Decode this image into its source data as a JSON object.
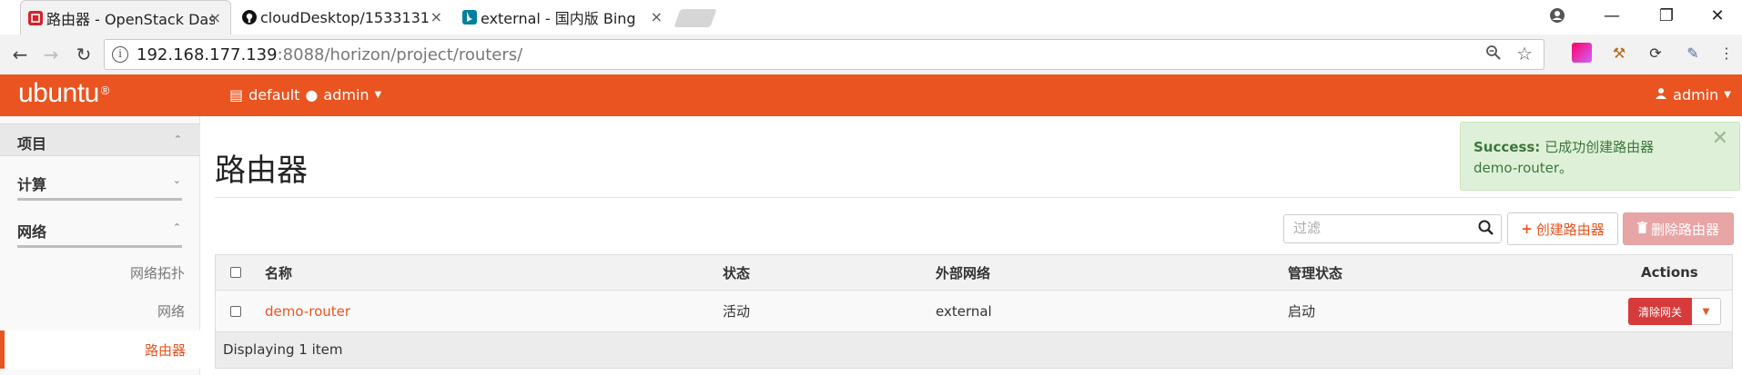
{
  "browser": {
    "tabs": [
      {
        "title": "路由器 - OpenStack Das",
        "favicon": "openstack-icon",
        "favicon_color": "#d2232a",
        "active": true
      },
      {
        "title": "cloudDesktop/1533131",
        "favicon": "github-icon",
        "active": false
      },
      {
        "title": "external - 国内版 Bing",
        "favicon": "bing-icon",
        "favicon_color": "#00809d",
        "active": false
      }
    ],
    "tab_close": "×",
    "url_host": "192.168.177.139",
    "url_rest": ":8088/horizon/project/routers/",
    "window_controls": {
      "minimize": "—",
      "maximize": "❐",
      "close": "✕"
    }
  },
  "header": {
    "brand": "ubuntu",
    "brand_mark": "®",
    "project_domain": "default",
    "project_name": "admin",
    "user": "admin",
    "bar_color": "#e95420"
  },
  "sidebar": {
    "project": "项目",
    "compute": "计算",
    "network": "网络",
    "items": [
      {
        "label": "网络拓扑"
      },
      {
        "label": "网络"
      },
      {
        "label": "路由器",
        "active": true
      }
    ]
  },
  "main": {
    "title": "路由器",
    "alert": {
      "strong": "Success:",
      "message_line1": "已成功创建路由器",
      "message_line2": "demo-router。"
    },
    "filter_placeholder": "过滤",
    "create_button": "创建路由器",
    "delete_button": "删除路由器",
    "table": {
      "headers": [
        "名称",
        "状态",
        "外部网络",
        "管理状态",
        "Actions"
      ],
      "rows": [
        {
          "name": "demo-router",
          "status": "活动",
          "external_network": "external",
          "admin_state": "启动",
          "action": "清除网关"
        }
      ],
      "footer": "Displaying 1 item"
    }
  }
}
